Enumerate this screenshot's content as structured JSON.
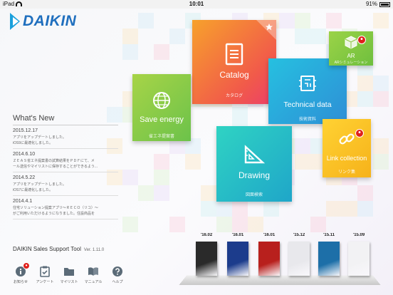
{
  "status_bar": {
    "device": "iPad",
    "time": "10:01",
    "battery": "91%"
  },
  "logo": {
    "text": "DAIKIN",
    "color": "#1f6fbe"
  },
  "tiles": {
    "catalog": {
      "label": "Catalog",
      "sub": "カタログ",
      "icon": "document-icon"
    },
    "save_energy": {
      "label": "Save energy",
      "sub": "省エネ提案書",
      "icon": "globe-icon"
    },
    "technical_data": {
      "label": "Technical data",
      "sub": "技術資料",
      "icon": "circuit-icon"
    },
    "ar": {
      "label": "AR",
      "sub": "ARシミュレーション",
      "icon": "cube-icon"
    },
    "drawing": {
      "label": "Drawing",
      "sub": "図面検索",
      "icon": "ruler-triangle-icon"
    },
    "link": {
      "label": "Link collection",
      "sub": "リンク集",
      "icon": "chain-link-icon"
    }
  },
  "news": {
    "title": "What's New",
    "items": [
      {
        "date": "2015.12.17",
        "body": "アプリをアップデートしました。\niOS9に最適化しました。"
      },
      {
        "date": "2014.6.10",
        "body": "ＺＥＡＳ省エネ提案書の試算結果をＰＤＦにて、メ\nール送信やマイリストに保存することができるよう..."
      },
      {
        "date": "2014.5.22",
        "body": "アプリをアップデートしました。\niOS7に最適化しました。"
      },
      {
        "date": "2014.4.1",
        "body": "住宅ソリューション提案アプリ～ＲＥＣＯ（リコ）～\nがご利用いただけるようになりました。住設商品を"
      }
    ]
  },
  "footer": {
    "app_name": "DAIKIN Sales Support Tool",
    "version": "Ver. 1.11.0"
  },
  "toolbar": [
    {
      "label": "お知らせ",
      "icon": "info-icon"
    },
    {
      "label": "アンケート",
      "icon": "survey-icon"
    },
    {
      "label": "マイリスト",
      "icon": "folder-icon"
    },
    {
      "label": "マニュアル",
      "icon": "book-icon"
    },
    {
      "label": "ヘルプ",
      "icon": "help-icon"
    }
  ],
  "shelf": [
    {
      "edition": "'16.02",
      "color": "#2a2a2a"
    },
    {
      "edition": "'16.01",
      "color": "#1c3c8c"
    },
    {
      "edition": "'16.01",
      "color": "#b8201d"
    },
    {
      "edition": "'15.12",
      "color": "#e8e8ec"
    },
    {
      "edition": "'15.11",
      "color": "#1d6fa8"
    },
    {
      "edition": "'15.09",
      "color": "#f2f2f4"
    }
  ],
  "colors": {
    "accent": "#1aa0dc",
    "badge": "#e0201b"
  }
}
